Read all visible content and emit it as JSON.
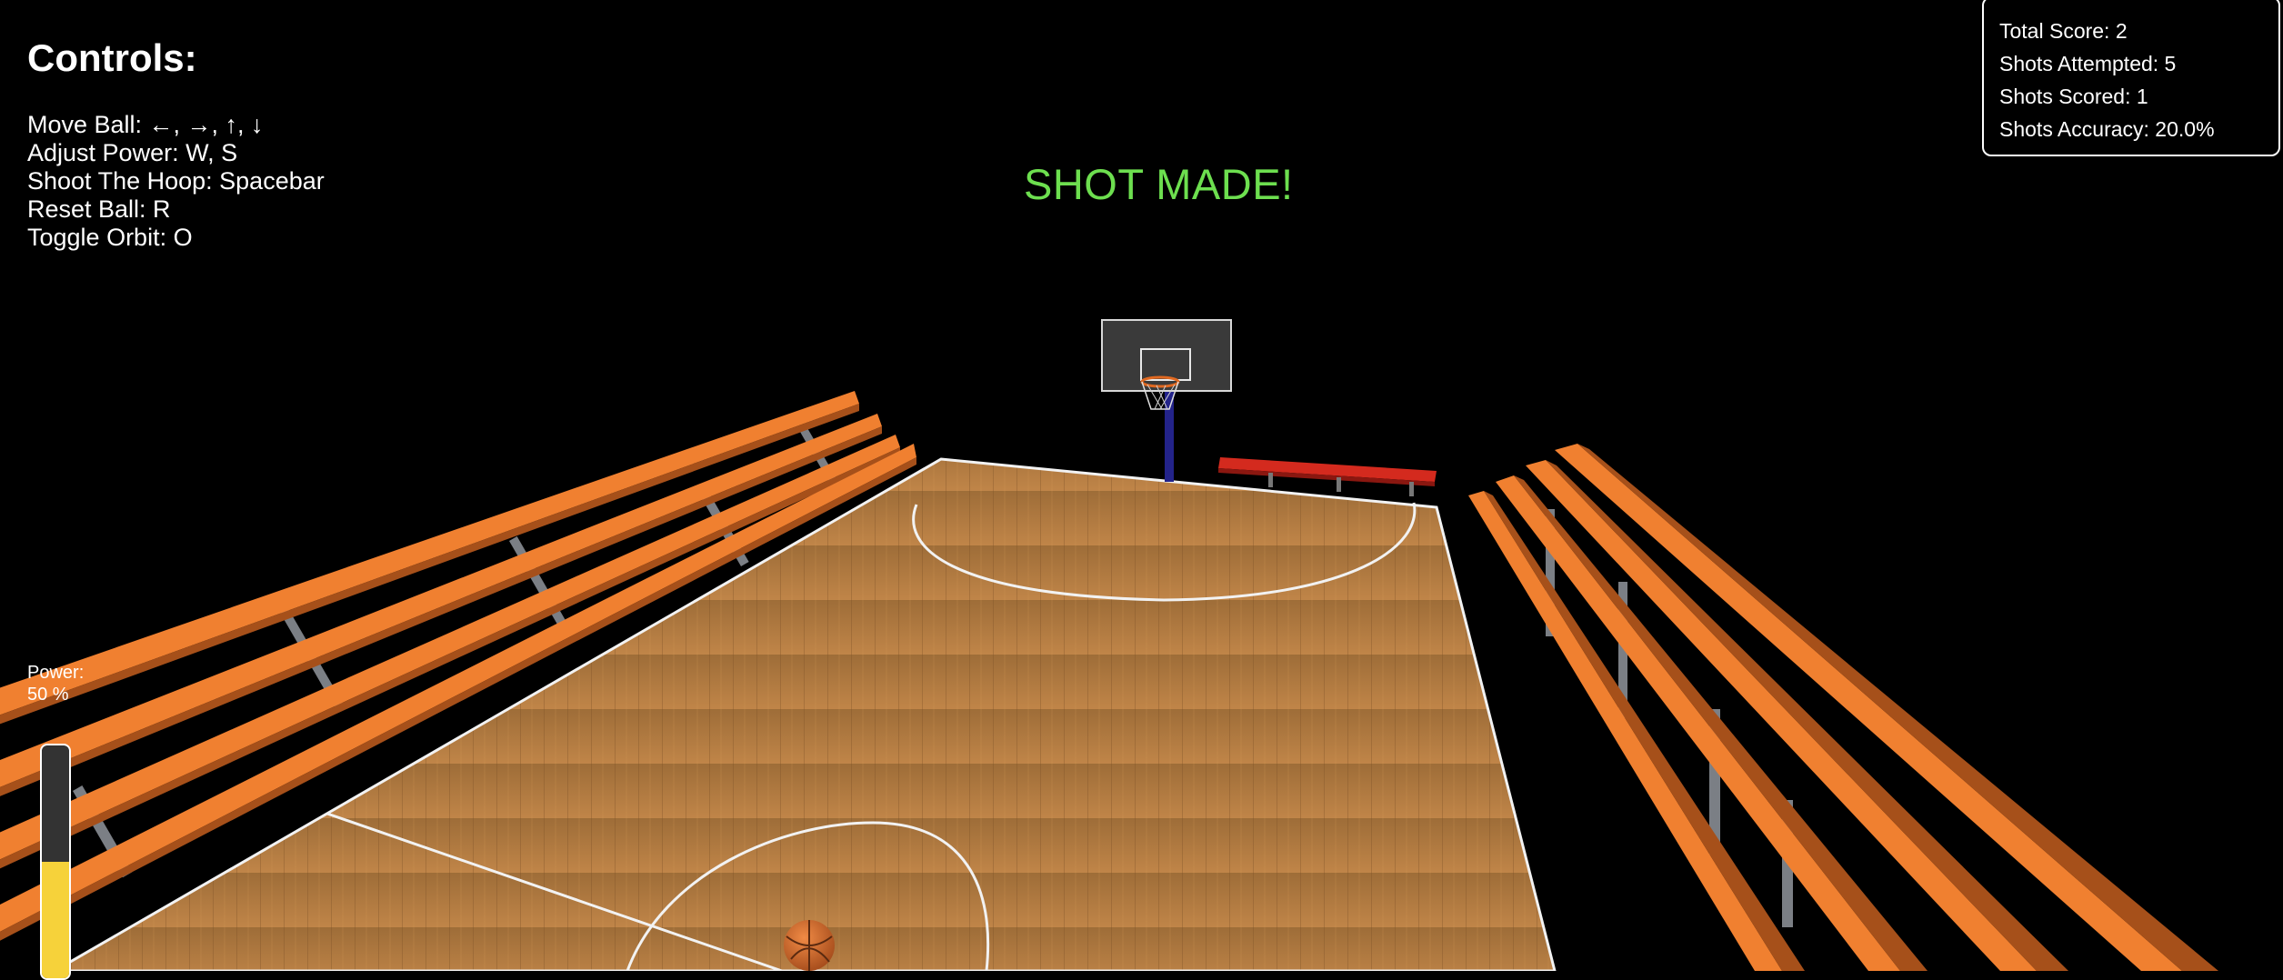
{
  "controls": {
    "title": "Controls:",
    "lines": [
      "Move Ball: ←, →, ↑, ↓",
      "Adjust Power: W, S",
      "Shoot The Hoop: Spacebar",
      "Reset Ball: R",
      "Toggle Orbit: O"
    ]
  },
  "scoreboard": {
    "total_score": "Total Score: 2",
    "shots_attempted": "Shots Attempted: 5",
    "shots_scored": "Shots Scored: 1",
    "shots_accuracy": "Shots Accuracy: 20.0%"
  },
  "status_message": "SHOT MADE!",
  "power": {
    "label": "Power:",
    "value_text": "50 %",
    "level": 0.5
  },
  "colors": {
    "background": "#000000",
    "message": "#6ddf4f",
    "bleachers": "#f08030",
    "court_wood": "#b57a3c",
    "power_fill": "#f6d23a",
    "bench": "#d42a1e",
    "pole": "#23238a",
    "ball": "#d0652a"
  }
}
